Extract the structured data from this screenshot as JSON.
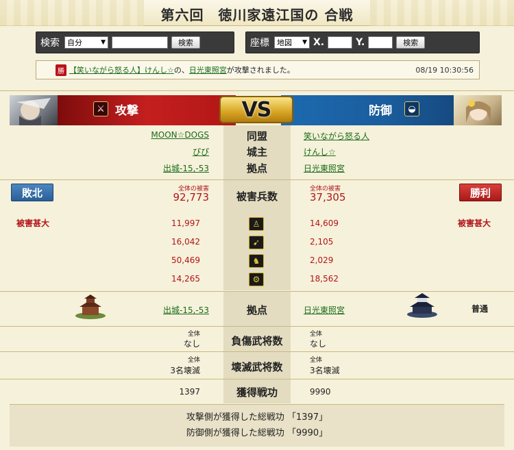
{
  "header": {
    "title": "第六回　徳川家遠江国の 合戦"
  },
  "search": {
    "label": "検索",
    "type_value": "自分",
    "button": "検索"
  },
  "coord_search": {
    "label": "座標",
    "map_value": "地図",
    "x_label": "X.",
    "y_label": "Y.",
    "button": "検索"
  },
  "notice": {
    "badge": "勝",
    "alliance_link": "【笑いながら怒る人】",
    "player_link": "けんし☆",
    "middle_text": "の、",
    "target_link": "日光東照宮",
    "suffix_text": "が攻撃されました。",
    "timestamp": "08/19 10:30:56"
  },
  "battle": {
    "attack_label": "攻撃",
    "defense_label": "防御",
    "vs_label": "VS",
    "attack_icon": "crossed-swords-icon",
    "defense_icon": "fan-icon",
    "rows": {
      "alliance_label": "同盟",
      "lord_label": "城主",
      "base_label": "拠点"
    },
    "attacker": {
      "alliance": "MOON☆DOGS",
      "lord": "ぴぴ",
      "base": "出城-15,-53",
      "result": "敗北",
      "damage_caption": "全体の被害",
      "damage_total": "92,773",
      "status": "被害甚大",
      "unit_losses": [
        "11,997",
        "16,042",
        "50,469",
        "14,265"
      ],
      "base2": "出城-15,-53",
      "injured_caption": "全体",
      "injured": "なし",
      "destroyed_caption": "全体",
      "destroyed": "3名壊滅",
      "merit": "1397"
    },
    "defender": {
      "alliance": "笑いながら怒る人",
      "lord": "けんし☆",
      "base": "日光東照宮",
      "result": "勝利",
      "damage_caption": "全体の被害",
      "damage_total": "37,305",
      "status": "被害甚大",
      "unit_losses": [
        "14,609",
        "2,105",
        "2,029",
        "18,562"
      ],
      "base2": "日光東照宮",
      "base2_status": "普通",
      "injured_caption": "全体",
      "injured": "なし",
      "destroyed_caption": "全体",
      "destroyed": "3名壊滅",
      "merit": "9990"
    },
    "mid_labels": {
      "damage": "被害兵数",
      "base": "拠点",
      "injured": "負傷武将数",
      "destroyed": "壊滅武将数",
      "merit": "獲得戦功"
    },
    "unit_icons": [
      "spear-soldier-icon",
      "bow-icon",
      "horse-icon",
      "siege-icon"
    ]
  },
  "summary": {
    "attacker_line": "攻撃側が獲得した総戦功 「1397」",
    "defender_line": "防御側が獲得した総戦功 「9990」"
  },
  "colors": {
    "attack_red": "#b11616",
    "defense_blue": "#1b5d9d",
    "background": "#f6f1da",
    "link_green": "#1a6b1a"
  }
}
